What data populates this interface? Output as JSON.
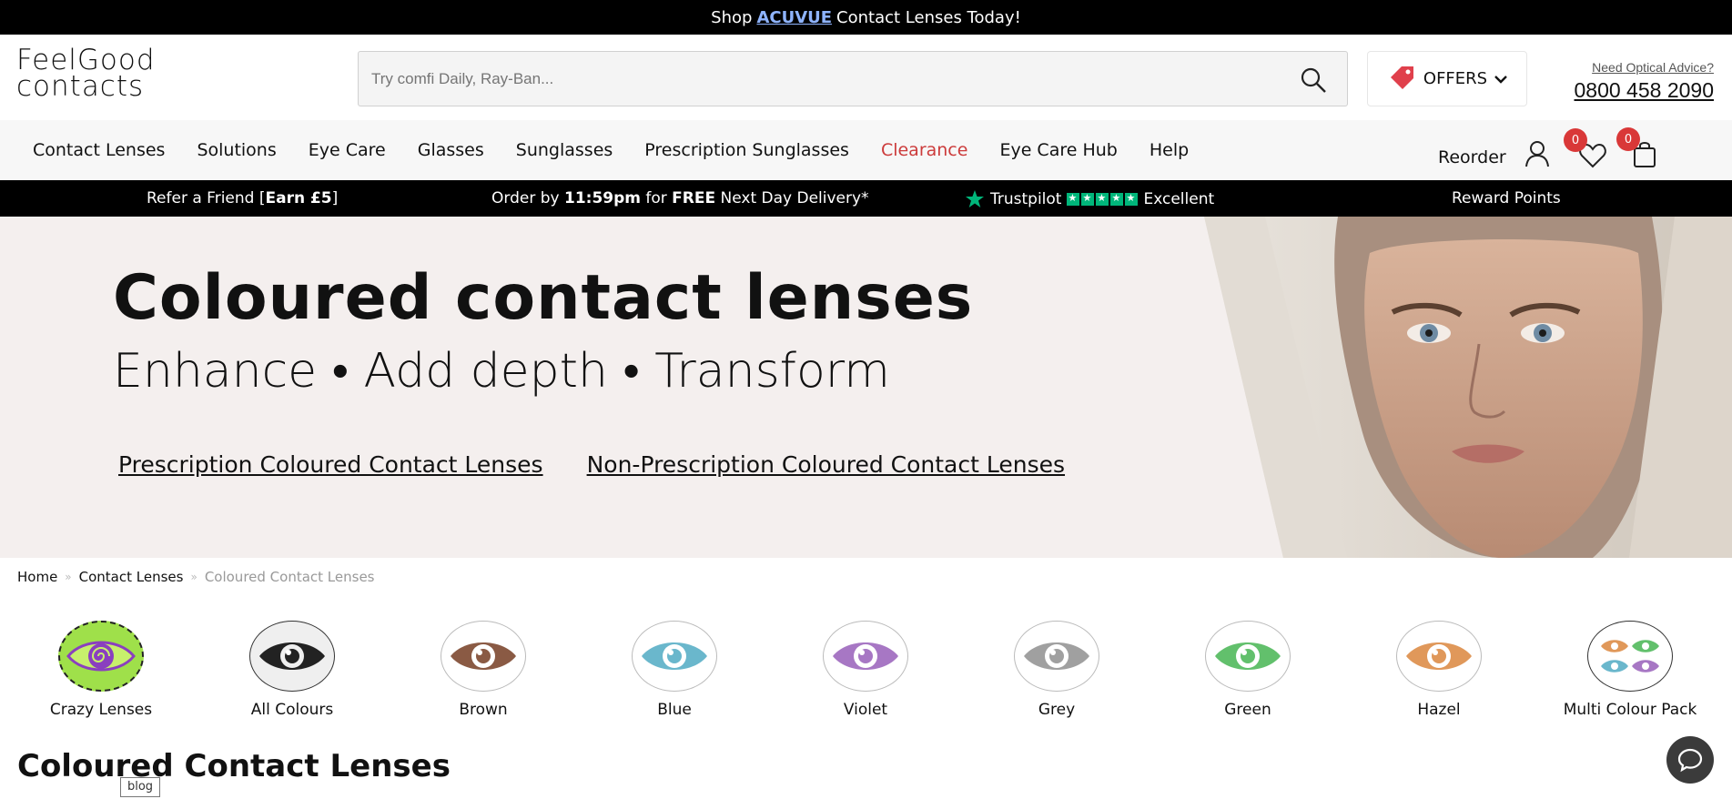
{
  "topbar": {
    "prefix": "Shop",
    "brand": "ACUVUE",
    "suffix": "Contact Lenses Today!"
  },
  "logo": {
    "line1": "FeelGood",
    "line2": "contacts"
  },
  "search": {
    "placeholder": "Try comfi Daily, Ray-Ban..."
  },
  "offers": {
    "label": "OFFERS"
  },
  "advice": {
    "question": "Need Optical Advice?",
    "phone": "0800 458 2090"
  },
  "nav": {
    "items": [
      "Contact Lenses",
      "Solutions",
      "Eye Care",
      "Glasses",
      "Sunglasses",
      "Prescription Sunglasses",
      "Clearance",
      "Eye Care Hub",
      "Help"
    ],
    "reorder": "Reorder",
    "wishlist_count": "0",
    "basket_count": "0"
  },
  "strip": {
    "refer_prefix": "Refer a Friend [",
    "refer_bold": "Earn £5",
    "refer_suffix": "]",
    "order_prefix": "Order by ",
    "order_time": "11:59pm",
    "order_mid": " for ",
    "order_free": "FREE",
    "order_suffix": " Next Day Delivery*",
    "trustpilot": "Trustpilot",
    "trustpilot_rating": "Excellent",
    "reward": "Reward Points"
  },
  "hero": {
    "title": "Coloured contact lenses",
    "tagline": "Enhance • Add depth • Transform",
    "link_prescription": "Prescription Coloured Contact Lenses",
    "link_nonprescription": "Non-Prescription Coloured Contact Lenses"
  },
  "breadcrumb": {
    "home": "Home",
    "sep": "»",
    "contact": "Contact Lenses",
    "current": "Coloured Contact Lenses"
  },
  "colours": [
    {
      "label": "Crazy Lenses",
      "color": "#9fe04a",
      "iris": "#8a3fbf"
    },
    {
      "label": "All Colours",
      "color": "#ffffff",
      "iris": "#222222"
    },
    {
      "label": "Brown",
      "color": "#ffffff",
      "iris": "#8a5a44"
    },
    {
      "label": "Blue",
      "color": "#ffffff",
      "iris": "#6ab7cc"
    },
    {
      "label": "Violet",
      "color": "#ffffff",
      "iris": "#a777c4"
    },
    {
      "label": "Grey",
      "color": "#ffffff",
      "iris": "#a0a0a0"
    },
    {
      "label": "Green",
      "color": "#ffffff",
      "iris": "#62c06c"
    },
    {
      "label": "Hazel",
      "color": "#ffffff",
      "iris": "#e0985a"
    },
    {
      "label": "Multi Colour Pack",
      "color": "#ffffff",
      "iris": "#e09a5a"
    }
  ],
  "page_title": "Coloured Contact Lenses",
  "blog_tag": "blog"
}
